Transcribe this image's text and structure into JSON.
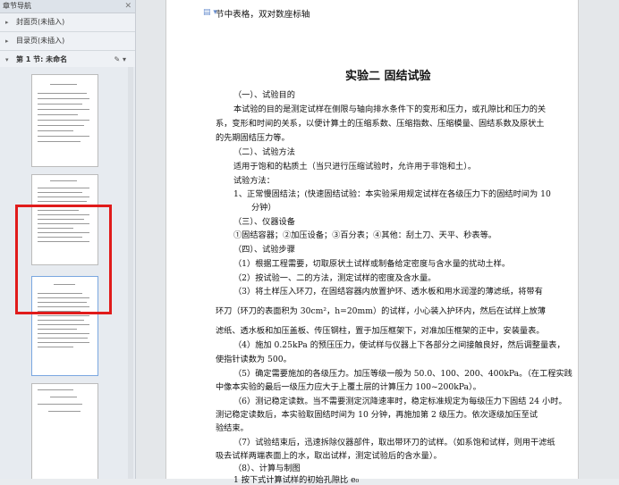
{
  "sidebar": {
    "title": "章节导航",
    "close": "✕",
    "items": [
      {
        "label": "封面页(未插入)"
      },
      {
        "label": "目录页(未插入)"
      },
      {
        "label": "第 1 节: 未命名"
      }
    ],
    "section_tools": "✎ ▾"
  },
  "document": {
    "header_line": "节中表格，双对数座标轴",
    "title": "实验二    固结试验",
    "paragraphs": [
      "（一）、试验目的",
      "本试验的目的是测定试样在侧限与轴向排水条件下的变形和压力，或孔隙比和压力的关",
      "系，变形和时间的关系，以便计算土的压缩系数、压缩指数、压缩模量、固结系数及原状土",
      "的先期固结压力等。",
      "（二）、试验方法",
      "适用于饱和的粘质土（当只进行压缩试验时，允许用于非饱和土）。",
      "试验方法：",
      "1、正常慢固结法；(快速固结试验：本实验采用规定试样在各级压力下的固结时间为 10",
      "分钟）",
      "（三）、仪器设备",
      "①固结容器；②加压设备；③百分表；④其他：刮土刀、天平、秒表等。",
      "（四）、试验步骤",
      "（1）根据工程需要，切取原状土试样或制备给定密度与含水量的扰动土样。",
      "（2）按试验一、二的方法，测定试样的密度及含水量。",
      "（3）将土样压入环刀，在固结容器内放置护环、透水板和用水润湿的薄滤纸，将带有",
      "环刀（环刀的表面积为 30cm²，h=20mm）的试样，小心装入护环内，然后在试样上放薄",
      "滤纸、透水板和加压盖板、传压钢柱，置于加压框架下，对准加压框架的正中，安装量表。",
      "（4）施加 0.25kPa 的预压压力，使试样与仪器上下各部分之间接触良好，然后调整量表，",
      "使指针读数为 500。",
      "（5）确定需要施加的各级压力。加压等级一般为 50.0、100、200、400kPa。（在工程实践",
      "中像本实验的最后一级压力应大于上覆土层的计算压力 100~200kPa）。",
      "（6）测记稳定读数。当不需要测定沉降速率时，稳定标准规定为每级压力下固结 24 小时。",
      "测记稳定读数后，本实验取固结时间为 10 分钟，再施加第 2 级压力。依次逐级加压至试",
      "验结束。",
      "（7）试验结束后，迅速拆除仪器部件，取出带环刀的试样。（如系饱和试样，则用干滤纸",
      "吸去试样两端表面上的水，取出试样，测定试验后的含水量）。",
      "（8）、计算与制图",
      "1 按下式计算试样的初始孔隙比 e₀"
    ]
  }
}
